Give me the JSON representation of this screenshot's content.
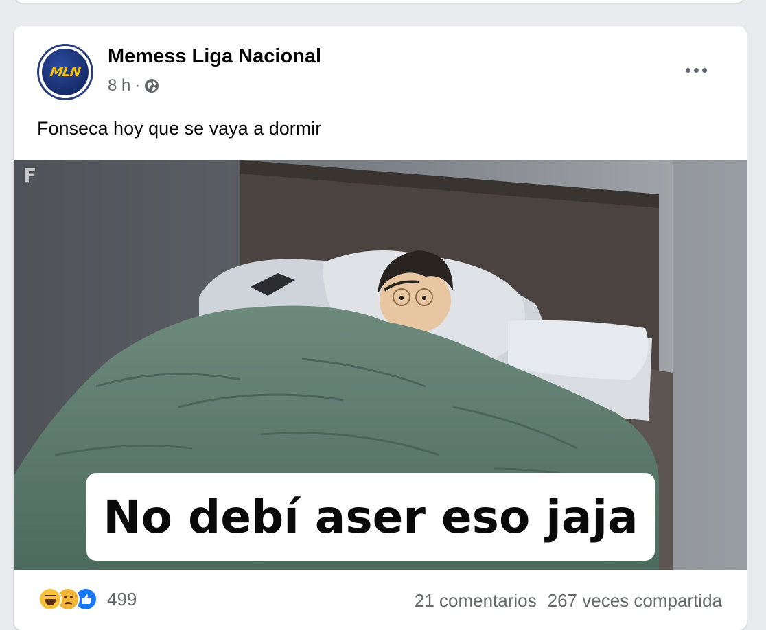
{
  "post": {
    "page_name": "Memess Liga Nacional",
    "avatar_text": "MLN",
    "time": "8 h",
    "separator": "·",
    "privacy_icon": "globe-icon",
    "more_icon": "more-options-icon",
    "caption": "Fonseca hoy que se vaya a dormir",
    "image": {
      "overlay_text": "No debí aser eso jaja",
      "watermark": "F"
    },
    "reactions": {
      "icons": [
        "haha-reaction-icon",
        "sad-reaction-icon",
        "like-reaction-icon"
      ],
      "count": "499"
    },
    "comments": "21 comentarios",
    "shares": "267 veces compartida"
  },
  "colors": {
    "background": "#e9ebee",
    "card": "#ffffff",
    "text_primary": "#050505",
    "text_secondary": "#65676b",
    "like_blue": "#1877f2",
    "blanket": "#5e7b6e",
    "logo_yellow": "#f3c21a",
    "logo_navy": "#0d1f52"
  }
}
